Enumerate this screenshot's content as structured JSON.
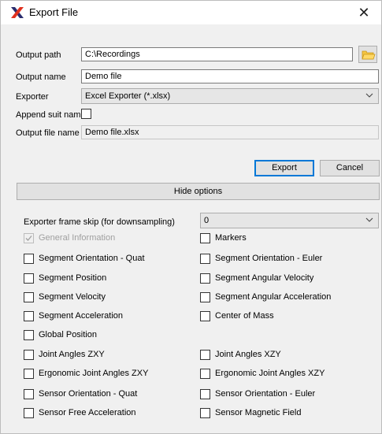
{
  "window": {
    "title": "Export File",
    "close_glyph": "✕"
  },
  "form": {
    "output_path_label": "Output path",
    "output_path_value": "C:\\Recordings",
    "output_name_label": "Output name",
    "output_name_value": "Demo file",
    "exporter_label": "Exporter",
    "exporter_value": "Excel Exporter (*.xlsx)",
    "append_suit_label": "Append suit name",
    "output_file_label": "Output file name",
    "output_file_value": "Demo file.xlsx"
  },
  "buttons": {
    "export": "Export",
    "cancel": "Cancel",
    "hide_options": "Hide options"
  },
  "options": {
    "frame_skip_label": "Exporter frame skip (for downsampling)",
    "frame_skip_value": "0",
    "items": [
      {
        "label": "General Information",
        "checked": true,
        "disabled": true
      },
      {
        "label": "Markers",
        "checked": false,
        "disabled": false
      },
      {
        "label": "Segment Orientation - Quat",
        "checked": false,
        "disabled": false
      },
      {
        "label": "Segment Orientation - Euler",
        "checked": false,
        "disabled": false
      },
      {
        "label": "Segment Position",
        "checked": false,
        "disabled": false
      },
      {
        "label": "Segment Angular Velocity",
        "checked": false,
        "disabled": false
      },
      {
        "label": "Segment Velocity",
        "checked": false,
        "disabled": false
      },
      {
        "label": "Segment Angular Acceleration",
        "checked": false,
        "disabled": false
      },
      {
        "label": "Segment Acceleration",
        "checked": false,
        "disabled": false
      },
      {
        "label": "Center of Mass",
        "checked": false,
        "disabled": false
      },
      {
        "label": "Global Position",
        "checked": false,
        "disabled": false
      },
      {
        "label": "Joint Angles ZXY",
        "checked": false,
        "disabled": false
      },
      {
        "label": "Joint Angles XZY",
        "checked": false,
        "disabled": false
      },
      {
        "label": "Ergonomic Joint Angles ZXY",
        "checked": false,
        "disabled": false
      },
      {
        "label": "Ergonomic Joint Angles XZY",
        "checked": false,
        "disabled": false
      },
      {
        "label": "Sensor Orientation - Quat",
        "checked": false,
        "disabled": false
      },
      {
        "label": "Sensor Orientation - Euler",
        "checked": false,
        "disabled": false
      },
      {
        "label": "Sensor Free Acceleration",
        "checked": false,
        "disabled": false
      },
      {
        "label": "Sensor Magnetic Field",
        "checked": false,
        "disabled": false
      }
    ]
  },
  "icons": {
    "app": "x-logo-icon",
    "folder": "folder-icon",
    "dropdown": "chevron-down-icon",
    "check": "checkmark-icon"
  },
  "colors": {
    "accent": "#0078d7",
    "logo": "#2b2d6e",
    "logo_accent": "#e0301e",
    "folder": "#f5c542"
  }
}
